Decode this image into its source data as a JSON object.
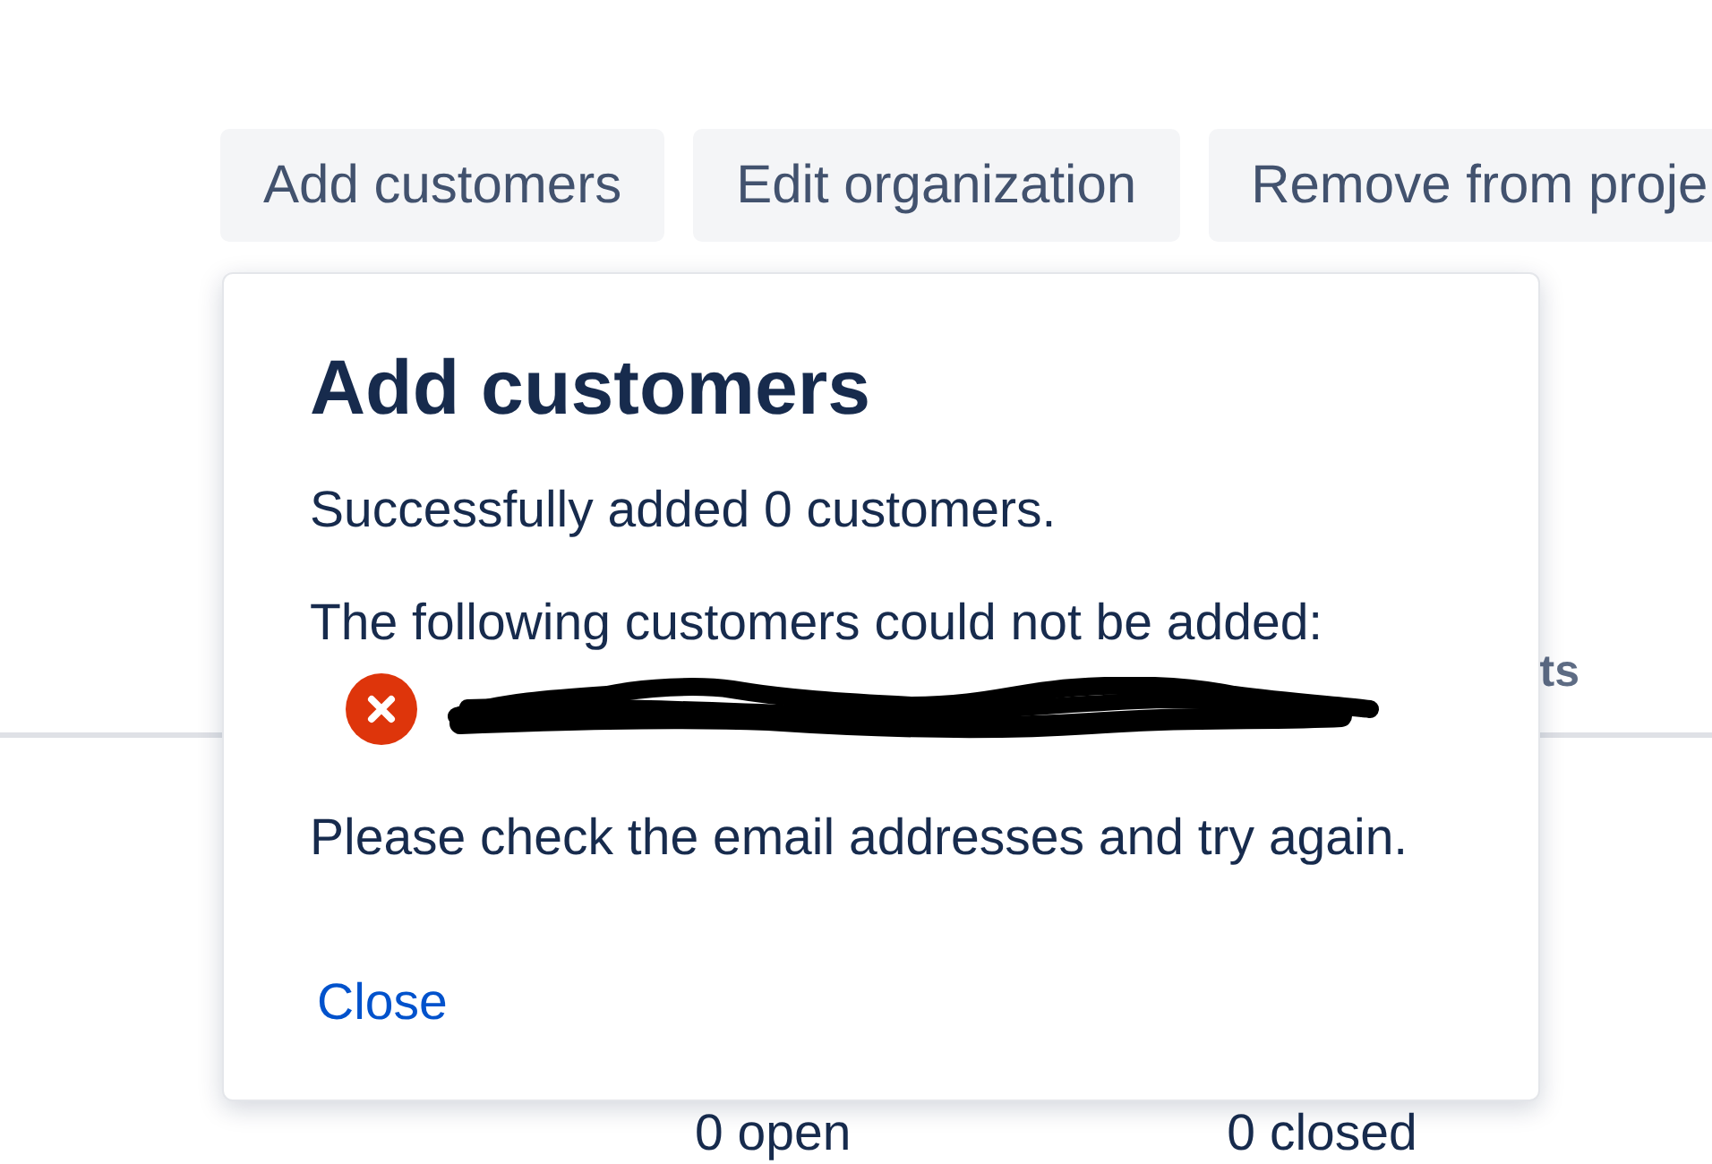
{
  "toolbar": {
    "buttons": [
      {
        "label": "Add customers"
      },
      {
        "label": "Edit organization"
      },
      {
        "label": "Remove from proje"
      }
    ]
  },
  "tabs": {
    "visible_label": "ts"
  },
  "counts": [
    "0 open",
    "0 closed"
  ],
  "dialog": {
    "title": "Add customers",
    "success_message": "Successfully added 0 customers.",
    "failure_heading": "The following customers could not be added:",
    "failed_customers": [
      {
        "kind": "error",
        "redacted": true
      }
    ],
    "hint": "Please check the email addresses and try again.",
    "close_link": "Close"
  }
}
